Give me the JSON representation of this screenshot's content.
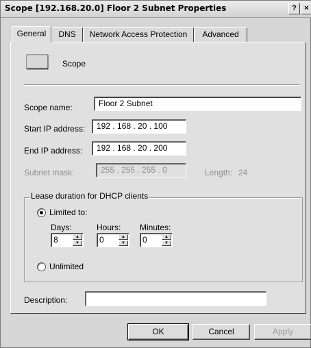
{
  "window": {
    "title": "Scope [192.168.20.0] Floor 2 Subnet Properties",
    "help_label": "?",
    "close_label": "×"
  },
  "tabs": [
    {
      "label": "General",
      "active": true
    },
    {
      "label": "DNS",
      "active": false
    },
    {
      "label": "Network Access Protection",
      "active": false
    },
    {
      "label": "Advanced",
      "active": false
    }
  ],
  "header": {
    "icon": "folder-icon",
    "label": "Scope"
  },
  "form": {
    "scope_name_label": "Scope name:",
    "scope_name_value": "Floor 2 Subnet",
    "start_ip_label": "Start IP address:",
    "start_ip_value": "192 . 168 .  20  . 100",
    "end_ip_label": "End IP address:",
    "end_ip_value": "192 . 168 .  20  . 200",
    "subnet_mask_label": "Subnet mask:",
    "subnet_mask_value": "255 . 255 . 255 .  0",
    "length_label": "Length:",
    "length_value": "24"
  },
  "lease": {
    "group_label": "Lease duration for DHCP clients",
    "limited_label": "Limited to:",
    "limited_selected": true,
    "days_label": "Days:",
    "days_value": "8",
    "hours_label": "Hours:",
    "hours_value": "0",
    "minutes_label": "Minutes:",
    "minutes_value": "0",
    "unlimited_label": "Unlimited",
    "unlimited_selected": false
  },
  "description": {
    "label": "Description:",
    "value": ""
  },
  "buttons": {
    "ok": "OK",
    "cancel": "Cancel",
    "apply": "Apply"
  },
  "colors": {
    "window_bg": "#d6d6d6",
    "panel_bg": "#e0e0e0",
    "disabled_text": "#8d8d8d"
  }
}
